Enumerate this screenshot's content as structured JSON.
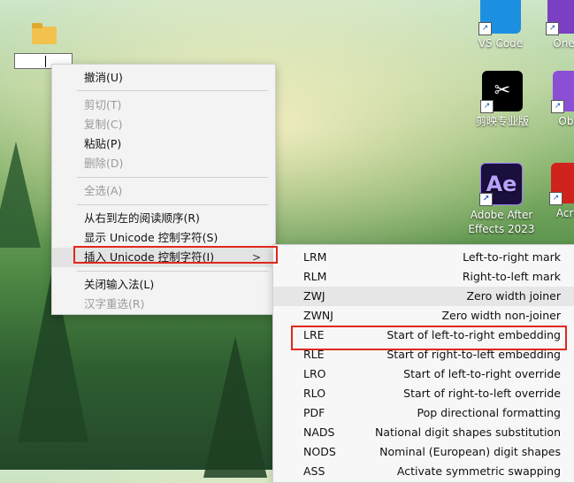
{
  "desktop": {
    "icons": [
      {
        "label": "VS Code",
        "icon": "vscode-icon"
      },
      {
        "label": "OneN",
        "icon": "onenote-icon"
      },
      {
        "label": "剪映专业版",
        "icon": "capcut-icon",
        "glyph": "✂"
      },
      {
        "label": "Obsic",
        "icon": "obsidian-icon"
      },
      {
        "label": "Adobe After Effects 2023",
        "line1": "Adobe After",
        "line2": "Effects 2023",
        "icon": "after-effects-icon",
        "glyph": "Ae"
      },
      {
        "label": "Acrob",
        "icon": "acrobat-icon"
      }
    ]
  },
  "context_menu": {
    "items": [
      {
        "label": "撤消(U)",
        "enabled": true
      },
      {
        "label": "剪切(T)",
        "enabled": false
      },
      {
        "label": "复制(C)",
        "enabled": false
      },
      {
        "label": "粘贴(P)",
        "enabled": true
      },
      {
        "label": "删除(D)",
        "enabled": false
      },
      {
        "label": "全选(A)",
        "enabled": false
      },
      {
        "label": "从右到左的阅读顺序(R)",
        "enabled": true
      },
      {
        "label": "显示 Unicode 控制字符(S)",
        "enabled": true
      },
      {
        "label": "插入 Unicode 控制字符(I)",
        "enabled": true,
        "submenu_arrow": ">"
      },
      {
        "label": "关闭输入法(L)",
        "enabled": true
      },
      {
        "label": "汉字重选(R)",
        "enabled": false
      }
    ]
  },
  "submenu": {
    "items": [
      {
        "code": "LRM",
        "desc": "Left-to-right mark"
      },
      {
        "code": "RLM",
        "desc": "Right-to-left mark"
      },
      {
        "code": "ZWJ",
        "desc": "Zero width joiner"
      },
      {
        "code": "ZWNJ",
        "desc": "Zero width non-joiner"
      },
      {
        "code": "LRE",
        "desc": "Start of left-to-right embedding"
      },
      {
        "code": "RLE",
        "desc": "Start of right-to-left embedding"
      },
      {
        "code": "LRO",
        "desc": "Start of left-to-right override"
      },
      {
        "code": "RLO",
        "desc": "Start of right-to-left override"
      },
      {
        "code": "PDF",
        "desc": "Pop directional formatting"
      },
      {
        "code": "NADS",
        "desc": "National digit shapes substitution"
      },
      {
        "code": "NODS",
        "desc": "Nominal (European) digit shapes"
      },
      {
        "code": "ASS",
        "desc": "Activate symmetric swapping"
      }
    ]
  },
  "colors": {
    "highlight_box": "#e0281f",
    "menu_bg": "#f3f3f3"
  }
}
